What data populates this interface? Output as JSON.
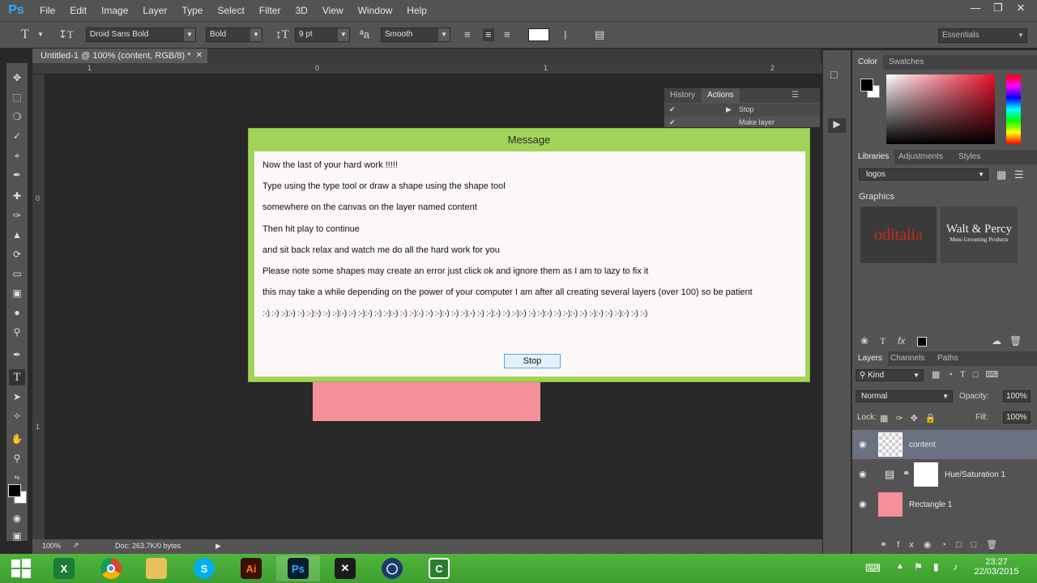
{
  "app": {
    "logo": "Ps",
    "menu": [
      "File",
      "Edit",
      "Image",
      "Layer",
      "Type",
      "Select",
      "Filter",
      "3D",
      "View",
      "Window",
      "Help"
    ]
  },
  "options": {
    "font_family": "Droid Sans Bold",
    "font_style": "Bold",
    "font_size": "9 pt",
    "antialias": "Smooth",
    "aa_glyph": "ªa",
    "workspace": "Essentials",
    "text_color": "#ffffff"
  },
  "document": {
    "tab_title": "Untitled-1 @ 100% (content, RGB/8) *",
    "ruler_h": [
      "1",
      "0",
      "1",
      "2"
    ],
    "ruler_v": [
      "0",
      "1"
    ],
    "zoom": "100%",
    "doc_info": "Doc: 263.7K/0 bytes",
    "rect_color": "#f5909b"
  },
  "history_panel": {
    "tabs": [
      "History",
      "Actions"
    ],
    "rows": [
      "Stop",
      "Make layer"
    ]
  },
  "dialog": {
    "title": "Message",
    "lines": [
      "Now the last of your hard work !!!!!",
      "Type using the type tool or draw a shape using the shape tool",
      "somewhere on the canvas on the layer named content",
      "Then hit play to continue",
      "and sit back relax and watch me do all the hard work for you",
      "Please note some shapes may create an error just click ok and ignore them as I am to lazy to fix it",
      "this may take a while depending on the power of your computer I am after all creating several layers (over 100) so be patient",
      ":-) :-) :-):-) :-) :-):-) :-) :-):-) :-) :-):-) :-) :-):-) :-) :-):-) :-) :-):-) :-) :-):-) :-) :-):-) :-) :-):-) :-) :-):-) :-) :-):-) :-) :-):-) :-) :-):-) :-) :-)"
    ],
    "button": "Stop",
    "frame_color": "#a3d45a"
  },
  "color_panel": {
    "tabs": [
      "Color",
      "Swatches"
    ]
  },
  "libraries_panel": {
    "tabs": [
      "Libraries",
      "Adjustments",
      "Styles"
    ],
    "library": "logos",
    "section": "Graphics",
    "logo1": "oditalia",
    "logo2_line1": "Walt & Percy",
    "logo2_line2": "Mens Grooming Products"
  },
  "layers_panel": {
    "tabs": [
      "Layers",
      "Channels",
      "Paths"
    ],
    "filter": "Kind",
    "blend": "Normal",
    "opacity_label": "Opacity:",
    "opacity": "100%",
    "lock_label": "Lock:",
    "fill_label": "Fill:",
    "fill": "100%",
    "layers": [
      "content",
      "Hue/Saturation 1",
      "Rectangle 1"
    ]
  },
  "taskbar": {
    "time": "23:27",
    "date": "22/03/2015",
    "apps": [
      "excel",
      "chrome",
      "explorer",
      "skype",
      "illustrator",
      "photoshop",
      "cinema",
      "steam",
      "camtasia"
    ]
  }
}
